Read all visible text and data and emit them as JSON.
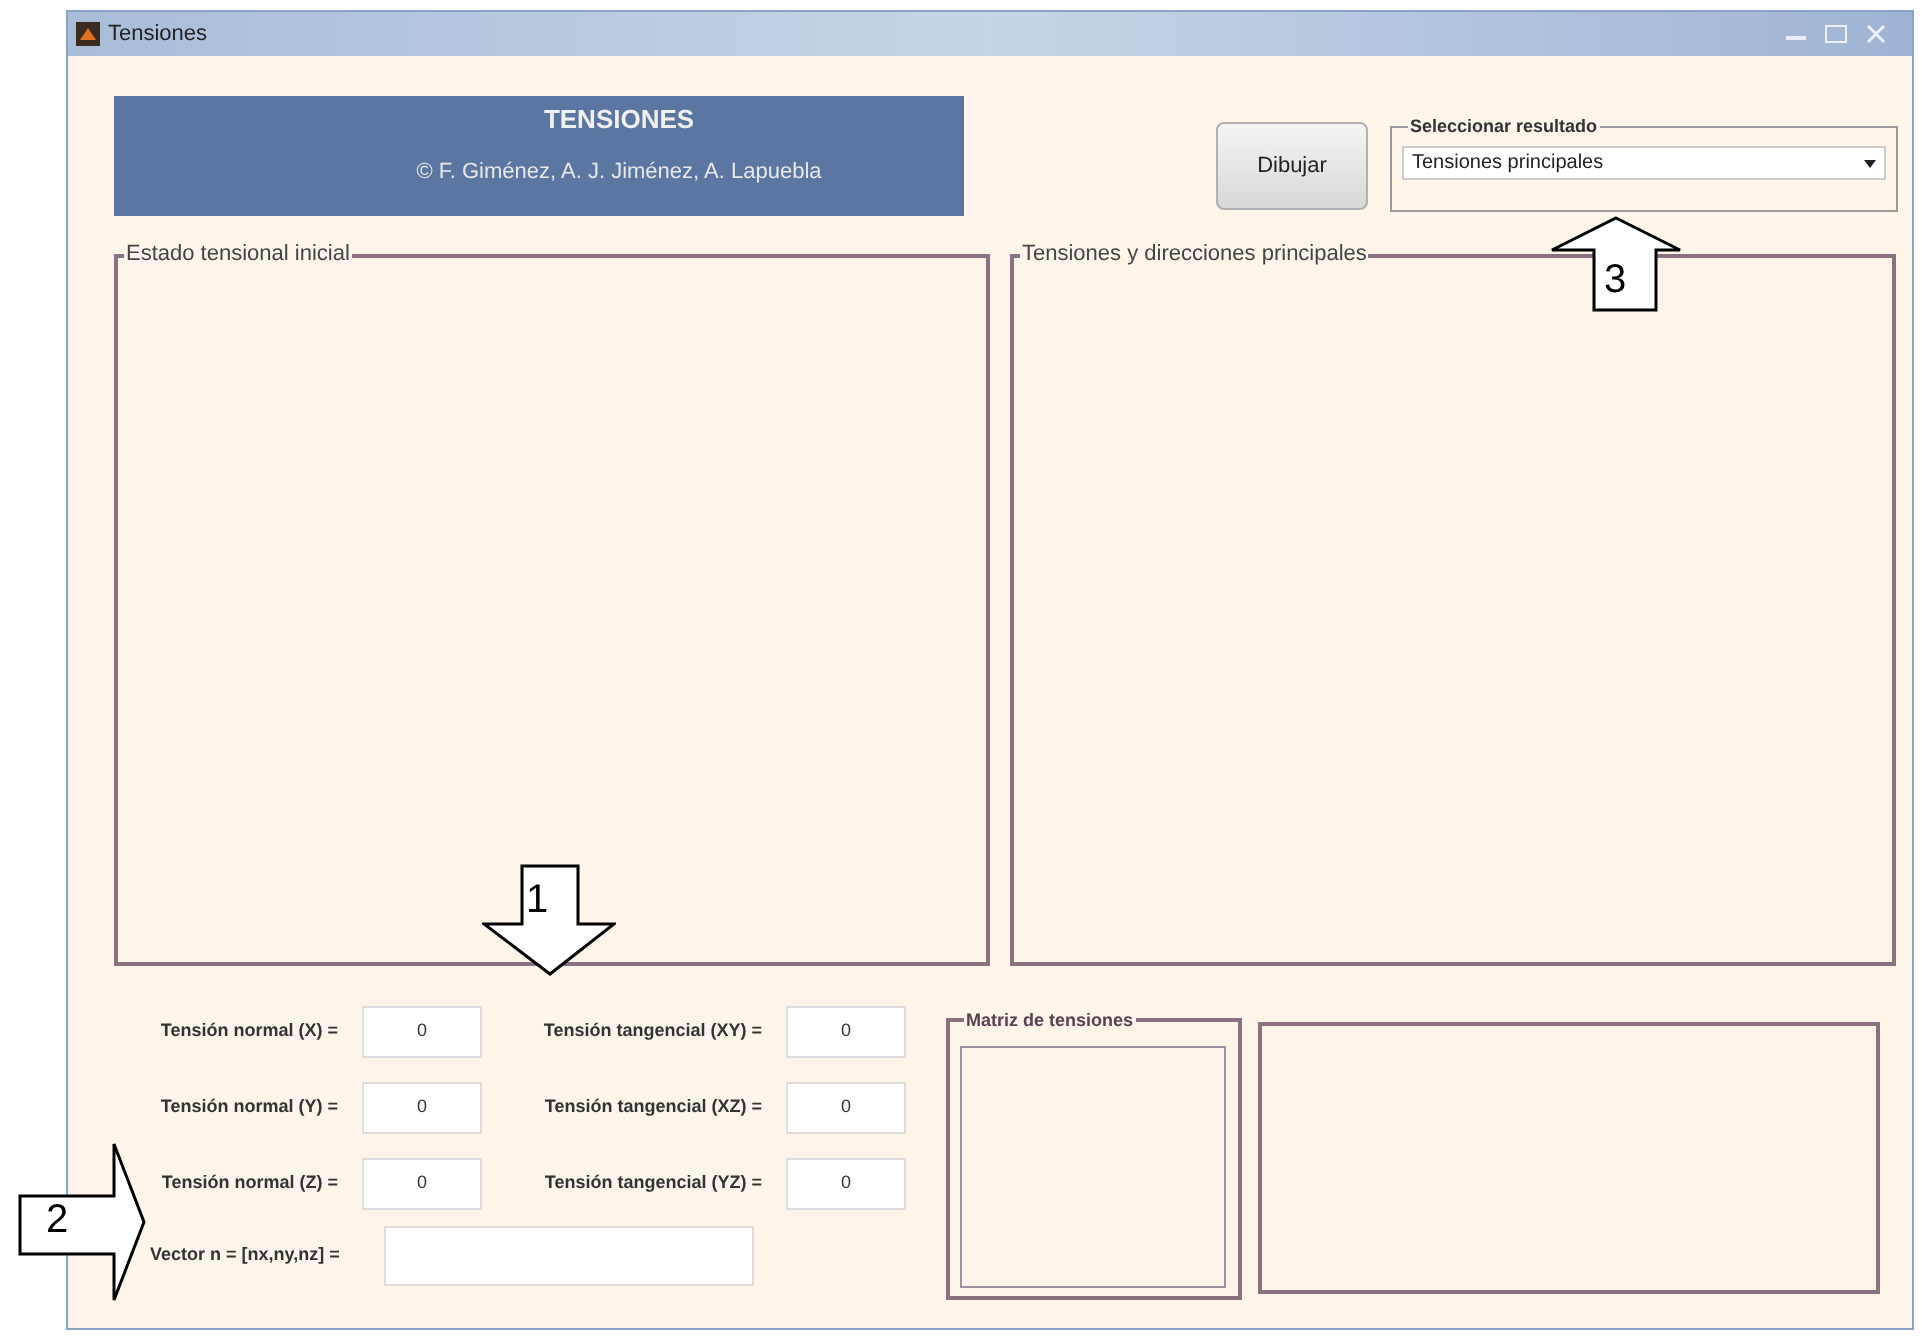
{
  "window": {
    "title": "Tensiones"
  },
  "header": {
    "title": "TENSIONES",
    "credits": "© F. Giménez, A. J. Jiménez, A. Lapuebla"
  },
  "draw_button": {
    "label": "Dibujar"
  },
  "result_select": {
    "group_label": "Seleccionar resultado",
    "value": "Tensiones principales"
  },
  "panels": [
    {
      "title": "Estado tensional inicial"
    },
    {
      "title": "Tensiones y direcciones principales"
    }
  ],
  "normal_inputs": [
    {
      "label": "Tensión normal (X) =",
      "value": "0"
    },
    {
      "label": "Tensión normal (Y) =",
      "value": "0"
    },
    {
      "label": "Tensión normal (Z) =",
      "value": "0"
    }
  ],
  "shear_inputs": [
    {
      "label": "Tensión tangencial (XY) =",
      "value": "0"
    },
    {
      "label": "Tensión tangencial (XZ) =",
      "value": "0"
    },
    {
      "label": "Tensión tangencial (YZ) =",
      "value": "0"
    }
  ],
  "vector_input": {
    "label": "Vector n = [nx,ny,nz] ="
  },
  "matrix_group": {
    "title": "Matriz de tensiones"
  },
  "callouts": [
    {
      "number": "1",
      "kind": "down"
    },
    {
      "number": "2",
      "kind": "right"
    },
    {
      "number": "3",
      "kind": "up"
    }
  ]
}
